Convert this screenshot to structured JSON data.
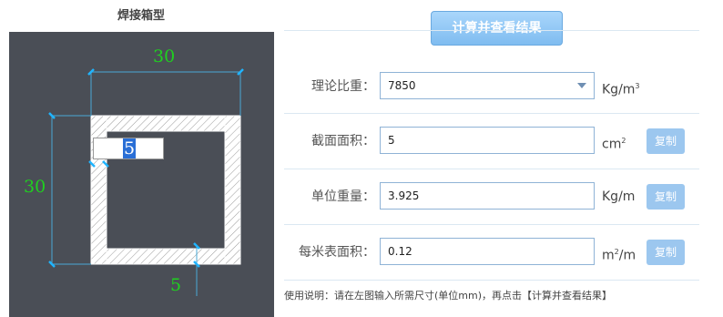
{
  "left_panel": {
    "title": "焊接箱型",
    "dims": {
      "width": "30",
      "height": "30",
      "thickness": "5"
    },
    "thickness_input_value": "5",
    "colors": {
      "canvas_bg": "#4a4e56",
      "dim_text": "#1fd11f",
      "dim_line": "#1fb4ff"
    }
  },
  "calc_button": {
    "label": "计算并查看结果"
  },
  "fields": [
    {
      "label": "理论比重：",
      "value": "7850",
      "unit_base": "Kg/m",
      "unit_sup": "3",
      "has_dropdown": true,
      "copy_label": ""
    },
    {
      "label": "截面面积：",
      "value": "5",
      "unit_base": "cm",
      "unit_sup": "2",
      "has_dropdown": false,
      "copy_label": "复制"
    },
    {
      "label": "单位重量：",
      "value": "3.925",
      "unit_base": "Kg/m",
      "unit_sup": "",
      "has_dropdown": false,
      "copy_label": "复制"
    },
    {
      "label": "每米表面积：",
      "value": "0.12",
      "unit_base": "m",
      "unit_sup": "2",
      "unit_tail": "/m",
      "has_dropdown": false,
      "copy_label": "复制"
    }
  ],
  "usage_note": "使用说明：请在左图输入所需尺寸(单位mm)，再点击【计算并查看结果】",
  "icons": {
    "dropdown": "chevron-down-icon"
  }
}
